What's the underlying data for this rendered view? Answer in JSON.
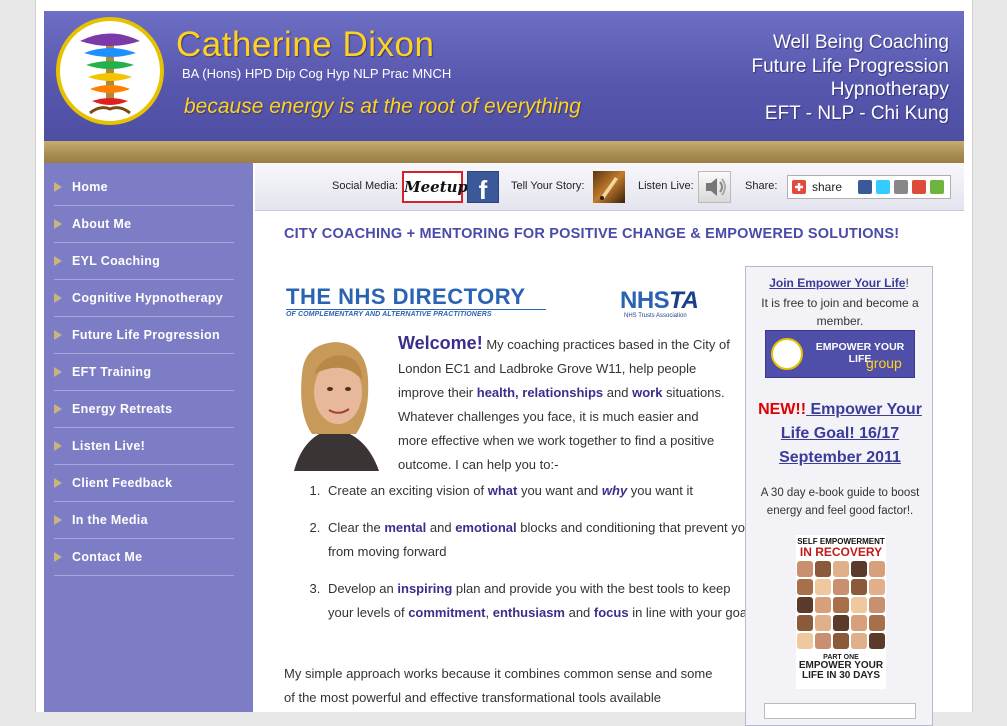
{
  "header": {
    "title": "Catherine Dixon",
    "credentials": "BA (Hons) HPD Dip Cog Hyp NLP Prac MNCH",
    "tagline": "because energy is at the root of everything",
    "services": [
      "Well Being Coaching",
      "Future Life Progression",
      "Hypnotherapy",
      "EFT - NLP - Chi Kung"
    ]
  },
  "nav": {
    "items": [
      {
        "label": "Home"
      },
      {
        "label": "About Me"
      },
      {
        "label": "EYL Coaching"
      },
      {
        "label": "Cognitive Hypnotherapy"
      },
      {
        "label": "Future Life Progression"
      },
      {
        "label": "EFT Training"
      },
      {
        "label": "Energy Retreats"
      },
      {
        "label": "Listen Live!"
      },
      {
        "label": "Client Feedback"
      },
      {
        "label": "In the Media"
      },
      {
        "label": "Contact Me"
      }
    ]
  },
  "social": {
    "social_media_label": "Social Media:",
    "meetup_text": "Meetup",
    "facebook_text": "f",
    "tell_story_label": "Tell Your Story:",
    "listen_live_label": "Listen Live:",
    "share_label": "Share:",
    "share_button_text": "share"
  },
  "main": {
    "heading": "CITY COACHING + MENTORING FOR POSITIVE CHANGE & EMPOWERED SOLUTIONS!",
    "nhs_directory_title": "THE NHS DIRECTORY",
    "nhs_directory_sub": "OF COMPLEMENTARY AND ALTERNATIVE PRACTITIONERS",
    "nhsta_logo_a": "NHS",
    "nhsta_logo_b": "TA",
    "nhsta_sub": "NHS Trusts Association",
    "welcome_word": "Welcome!",
    "welcome_1": " My coaching practices based in the City of London EC1 and Ladbroke Grove W11, help people improve their ",
    "welcome_health": "health, relationships",
    "welcome_and": " and ",
    "welcome_work": "work",
    "welcome_2": " situations. Whatever challenges you face, it is much easier and more effective when we work together to find a positive outcome. I can help you to:-",
    "goals": [
      {
        "a": "Create an exciting vision of ",
        "b": "what",
        "c": " you want and ",
        "d": "why",
        "e": " you want it"
      },
      {
        "a": "Clear the ",
        "b": "mental",
        "c": " and ",
        "d": "emotional",
        "e": " blocks and conditioning that prevent you from moving forward"
      },
      {
        "a": "Develop an ",
        "b": "inspiring",
        "c": " plan and provide you with the best tools to keep your levels of ",
        "d": "commitment",
        "e": ", ",
        "f": "enthusiasm",
        "g": " and ",
        "h": "focus",
        "i": " in line with your goal."
      }
    ],
    "approach": "My simple approach works because it combines common sense and some of the most powerful and effective transformational tools available"
  },
  "sidebox": {
    "join_link": "Join Empower Your Life",
    "join_excl": "!",
    "join_desc": "It is free to join and become a member.",
    "group_line1": "EMPOWER YOUR LIFE",
    "group_line2": "group",
    "new_label": "NEW!!",
    "event_text": " Empower Your Life  Goal! 16/17 September 2011",
    "ebook_desc": "A 30 day e-book guide to boost energy and feel good factor!.",
    "ebook_top": "SELF EMPOWERMENT",
    "ebook_top2": "IN RECOVERY",
    "ebook_part": "PART ONE",
    "ebook_bottom": "EMPOWER YOUR LIFE IN 30 DAYS"
  },
  "colors": {
    "header_purple": "#5757ae",
    "sidebar_purple": "#7d7dc6",
    "gold": "#ffd21f",
    "link_purple": "#3b2f8c",
    "new_red": "#e00000"
  }
}
